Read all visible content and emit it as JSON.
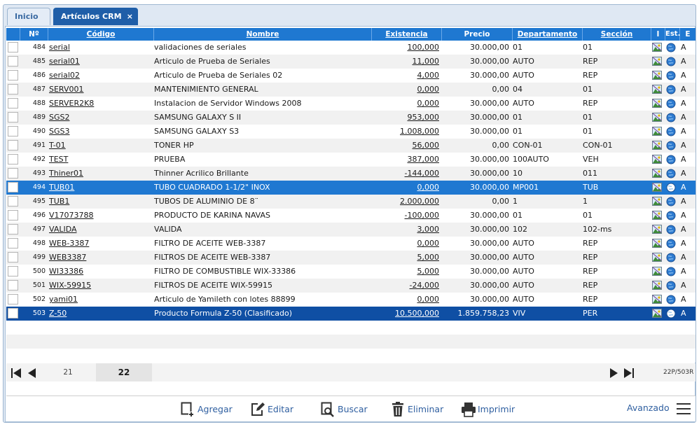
{
  "tabs": [
    {
      "label": "Inicio"
    },
    {
      "label": "Artículos CRM",
      "close": "×"
    }
  ],
  "columns": {
    "n": "Nº",
    "code": "Código",
    "name": "Nombre",
    "existencia": "Existencia",
    "precio": "Precio",
    "departamento": "Departamento",
    "seccion": "Sección",
    "i": "I",
    "est": "Est.",
    "e": "E"
  },
  "rows": [
    {
      "n": "484",
      "code": "serial",
      "name": "validaciones de seriales",
      "exist": "100,000",
      "price": "30.000,00",
      "dept": "01",
      "sec": "01",
      "est": "A"
    },
    {
      "n": "485",
      "code": "serial01",
      "name": "Articulo de Prueba de Seriales",
      "exist": "11,000",
      "price": "30.000,00",
      "dept": "AUTO",
      "sec": "REP",
      "est": "A"
    },
    {
      "n": "486",
      "code": "serial02",
      "name": "Articulo de Prueba de Seriales 02",
      "exist": "4,000",
      "price": "30.000,00",
      "dept": "AUTO",
      "sec": "REP",
      "est": "A"
    },
    {
      "n": "487",
      "code": "SERV001",
      "name": "MANTENIMIENTO GENERAL",
      "exist": "0,000",
      "price": "0,00",
      "dept": "04",
      "sec": "01",
      "est": "A"
    },
    {
      "n": "488",
      "code": "SERVER2K8",
      "name": "Instalacion de Servidor Windows 2008",
      "exist": "0,000",
      "price": "30.000,00",
      "dept": "AUTO",
      "sec": "REP",
      "est": "A"
    },
    {
      "n": "489",
      "code": "SGS2",
      "name": "SAMSUNG GALAXY S II",
      "exist": "953,000",
      "price": "30.000,00",
      "dept": "01",
      "sec": "01",
      "est": "A"
    },
    {
      "n": "490",
      "code": "SGS3",
      "name": "SAMSUNG GALAXY S3",
      "exist": "1.008,000",
      "price": "30.000,00",
      "dept": "01",
      "sec": "01",
      "est": "A"
    },
    {
      "n": "491",
      "code": "T-01",
      "name": "TONER HP",
      "exist": "56,000",
      "price": "0,00",
      "dept": "CON-01",
      "sec": "CON-01",
      "est": "A"
    },
    {
      "n": "492",
      "code": "TEST",
      "name": "PRUEBA",
      "exist": "387,000",
      "price": "30.000,00",
      "dept": "100AUTO",
      "sec": "VEH",
      "est": "A"
    },
    {
      "n": "493",
      "code": "Thiner01",
      "name": "Thinner Acrilico Brillante",
      "exist": "-144,000",
      "price": "30.000,00",
      "dept": "10",
      "sec": "011",
      "est": "A"
    },
    {
      "n": "494",
      "code": "TUB01",
      "name": "TUBO CUADRADO 1-1/2\" INOX",
      "exist": "0,000",
      "price": "30.000,00",
      "dept": "MP001",
      "sec": "TUB",
      "est": "A"
    },
    {
      "n": "495",
      "code": "TUB1",
      "name": "TUBOS DE ALUMINIO DE 8¨",
      "exist": "2.000,000",
      "price": "0,00",
      "dept": "1",
      "sec": "1",
      "est": "A"
    },
    {
      "n": "496",
      "code": "V17073788",
      "name": "PRODUCTO DE KARINA NAVAS",
      "exist": "-100,000",
      "price": "30.000,00",
      "dept": "01",
      "sec": "01",
      "est": "A"
    },
    {
      "n": "497",
      "code": "VALIDA",
      "name": "VALIDA",
      "exist": "3,000",
      "price": "30.000,00",
      "dept": "102",
      "sec": "102-ms",
      "est": "A"
    },
    {
      "n": "498",
      "code": "WEB-3387",
      "name": "FILTRO DE ACEITE WEB-3387",
      "exist": "0,000",
      "price": "30.000,00",
      "dept": "AUTO",
      "sec": "REP",
      "est": "A"
    },
    {
      "n": "499",
      "code": "WEB3387",
      "name": "FILTROS DE ACEITE WEB-3387",
      "exist": "5,000",
      "price": "30.000,00",
      "dept": "AUTO",
      "sec": "REP",
      "est": "A"
    },
    {
      "n": "500",
      "code": "WI33386",
      "name": "FILTRO DE COMBUSTIBLE WIX-33386",
      "exist": "5,000",
      "price": "30.000,00",
      "dept": "AUTO",
      "sec": "REP",
      "est": "A"
    },
    {
      "n": "501",
      "code": "WIX-59915",
      "name": "FILTROS DE ACEITE WIX-59915",
      "exist": "-24,000",
      "price": "30.000,00",
      "dept": "AUTO",
      "sec": "REP",
      "est": "A"
    },
    {
      "n": "502",
      "code": "yami01",
      "name": "Articulo de Yamileth con lotes 88899",
      "exist": "0,000",
      "price": "30.000,00",
      "dept": "AUTO",
      "sec": "REP",
      "est": "A"
    },
    {
      "n": "503",
      "code": "Z-50",
      "name": "Producto Formula Z-50 (Clasificado)",
      "exist": "10.500,000",
      "price": "1.859.758,23",
      "dept": "VIV",
      "sec": "PER",
      "est": "A"
    }
  ],
  "pager": {
    "prev_page": "21",
    "current_page": "22",
    "info": "22P/503R"
  },
  "toolbar": {
    "add": "Agregar",
    "edit": "Editar",
    "search": "Buscar",
    "delete": "Eliminar",
    "print": "Imprimir",
    "advanced": "Avanzado"
  },
  "colors": {
    "header_blue": "#1f78d1",
    "selected_row": "#1f78d1",
    "focused_row": "#0f4fa4",
    "tab_active": "#1f5ea8",
    "link_blue": "#2f5fa0"
  },
  "icons": {
    "row_image": "image-icon",
    "row_globe": "globe-icon",
    "first": "first-page-icon",
    "prev": "prev-page-icon",
    "next": "next-page-icon",
    "last": "last-page-icon",
    "add": "add-document-icon",
    "edit": "edit-icon",
    "search": "search-document-icon",
    "delete": "trash-icon",
    "print": "printer-icon",
    "menu": "hamburger-menu-icon"
  }
}
